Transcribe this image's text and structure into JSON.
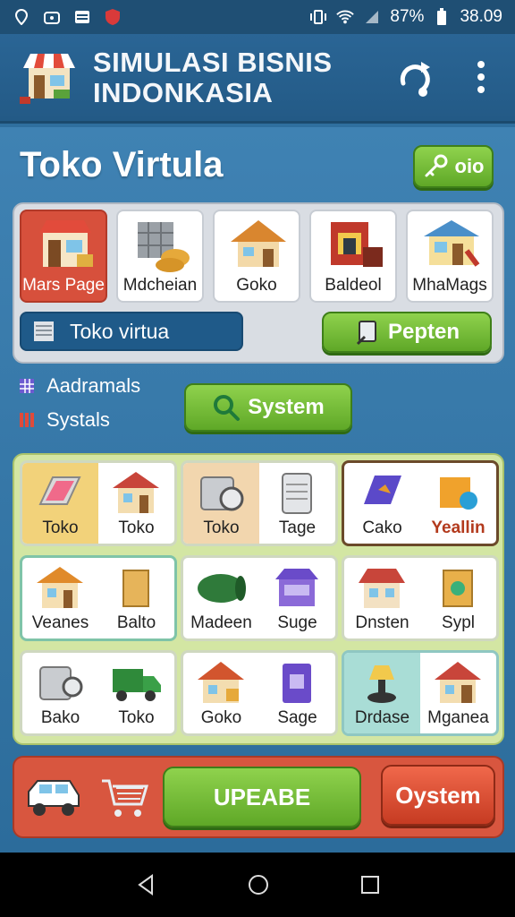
{
  "status": {
    "battery": "87%",
    "time": "38.09"
  },
  "header": {
    "title_line1": "SIMULASI BISNIS",
    "title_line2": "INDONKASIA"
  },
  "page": {
    "title": "Toko Virtula",
    "top_button": "oio"
  },
  "categories": [
    {
      "label": "Mars Page",
      "icon": "shop-icon",
      "active": true
    },
    {
      "label": "Mdcheian",
      "icon": "crates-icon",
      "active": false
    },
    {
      "label": "Goko",
      "icon": "house-icon",
      "active": false
    },
    {
      "label": "Baldeol",
      "icon": "building-icon",
      "active": false
    },
    {
      "label": "MhaMags",
      "icon": "market-icon",
      "active": false
    }
  ],
  "search": {
    "value": "Toko virtua"
  },
  "pepten_button": "Pepten",
  "legend": [
    {
      "label": "Aadramals",
      "icon": "grid-icon"
    },
    {
      "label": "Systals",
      "icon": "bars-icon"
    }
  ],
  "system_button": "System",
  "grid": [
    {
      "left": "Toko",
      "right": "Toko"
    },
    {
      "left": "Toko",
      "right": "Tage"
    },
    {
      "left": "Cako",
      "right": "Yeallin"
    },
    {
      "left": "Veanes",
      "right": "Balto"
    },
    {
      "left": "Madeen",
      "right": "Suge"
    },
    {
      "left": "Dnsten",
      "right": "Sypl"
    },
    {
      "left": "Bako",
      "right": "Toko"
    },
    {
      "left": "Goko",
      "right": "Sage"
    },
    {
      "left": "Drdase",
      "right": "Mganea"
    }
  ],
  "bottom": {
    "upgrade_button": "UPEABE",
    "system_button": "Oystem"
  },
  "colors": {
    "accent_green": "#6fbc33",
    "accent_red": "#d8563f",
    "header_blue": "#235a86",
    "highlight_yellow": "#b33a1d"
  }
}
